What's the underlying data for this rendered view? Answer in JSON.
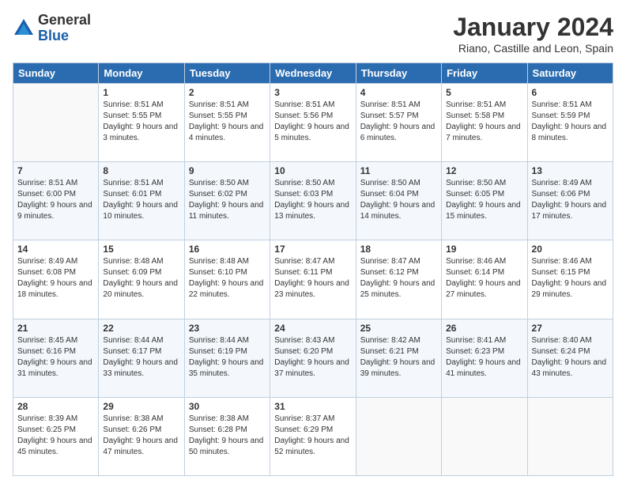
{
  "logo": {
    "general": "General",
    "blue": "Blue"
  },
  "header": {
    "title": "January 2024",
    "subtitle": "Riano, Castille and Leon, Spain"
  },
  "weekdays": [
    "Sunday",
    "Monday",
    "Tuesday",
    "Wednesday",
    "Thursday",
    "Friday",
    "Saturday"
  ],
  "weeks": [
    [
      {
        "day": "",
        "sunrise": "",
        "sunset": "",
        "daylight": ""
      },
      {
        "day": "1",
        "sunrise": "Sunrise: 8:51 AM",
        "sunset": "Sunset: 5:55 PM",
        "daylight": "Daylight: 9 hours and 3 minutes."
      },
      {
        "day": "2",
        "sunrise": "Sunrise: 8:51 AM",
        "sunset": "Sunset: 5:55 PM",
        "daylight": "Daylight: 9 hours and 4 minutes."
      },
      {
        "day": "3",
        "sunrise": "Sunrise: 8:51 AM",
        "sunset": "Sunset: 5:56 PM",
        "daylight": "Daylight: 9 hours and 5 minutes."
      },
      {
        "day": "4",
        "sunrise": "Sunrise: 8:51 AM",
        "sunset": "Sunset: 5:57 PM",
        "daylight": "Daylight: 9 hours and 6 minutes."
      },
      {
        "day": "5",
        "sunrise": "Sunrise: 8:51 AM",
        "sunset": "Sunset: 5:58 PM",
        "daylight": "Daylight: 9 hours and 7 minutes."
      },
      {
        "day": "6",
        "sunrise": "Sunrise: 8:51 AM",
        "sunset": "Sunset: 5:59 PM",
        "daylight": "Daylight: 9 hours and 8 minutes."
      }
    ],
    [
      {
        "day": "7",
        "sunrise": "Sunrise: 8:51 AM",
        "sunset": "Sunset: 6:00 PM",
        "daylight": "Daylight: 9 hours and 9 minutes."
      },
      {
        "day": "8",
        "sunrise": "Sunrise: 8:51 AM",
        "sunset": "Sunset: 6:01 PM",
        "daylight": "Daylight: 9 hours and 10 minutes."
      },
      {
        "day": "9",
        "sunrise": "Sunrise: 8:50 AM",
        "sunset": "Sunset: 6:02 PM",
        "daylight": "Daylight: 9 hours and 11 minutes."
      },
      {
        "day": "10",
        "sunrise": "Sunrise: 8:50 AM",
        "sunset": "Sunset: 6:03 PM",
        "daylight": "Daylight: 9 hours and 13 minutes."
      },
      {
        "day": "11",
        "sunrise": "Sunrise: 8:50 AM",
        "sunset": "Sunset: 6:04 PM",
        "daylight": "Daylight: 9 hours and 14 minutes."
      },
      {
        "day": "12",
        "sunrise": "Sunrise: 8:50 AM",
        "sunset": "Sunset: 6:05 PM",
        "daylight": "Daylight: 9 hours and 15 minutes."
      },
      {
        "day": "13",
        "sunrise": "Sunrise: 8:49 AM",
        "sunset": "Sunset: 6:06 PM",
        "daylight": "Daylight: 9 hours and 17 minutes."
      }
    ],
    [
      {
        "day": "14",
        "sunrise": "Sunrise: 8:49 AM",
        "sunset": "Sunset: 6:08 PM",
        "daylight": "Daylight: 9 hours and 18 minutes."
      },
      {
        "day": "15",
        "sunrise": "Sunrise: 8:48 AM",
        "sunset": "Sunset: 6:09 PM",
        "daylight": "Daylight: 9 hours and 20 minutes."
      },
      {
        "day": "16",
        "sunrise": "Sunrise: 8:48 AM",
        "sunset": "Sunset: 6:10 PM",
        "daylight": "Daylight: 9 hours and 22 minutes."
      },
      {
        "day": "17",
        "sunrise": "Sunrise: 8:47 AM",
        "sunset": "Sunset: 6:11 PM",
        "daylight": "Daylight: 9 hours and 23 minutes."
      },
      {
        "day": "18",
        "sunrise": "Sunrise: 8:47 AM",
        "sunset": "Sunset: 6:12 PM",
        "daylight": "Daylight: 9 hours and 25 minutes."
      },
      {
        "day": "19",
        "sunrise": "Sunrise: 8:46 AM",
        "sunset": "Sunset: 6:14 PM",
        "daylight": "Daylight: 9 hours and 27 minutes."
      },
      {
        "day": "20",
        "sunrise": "Sunrise: 8:46 AM",
        "sunset": "Sunset: 6:15 PM",
        "daylight": "Daylight: 9 hours and 29 minutes."
      }
    ],
    [
      {
        "day": "21",
        "sunrise": "Sunrise: 8:45 AM",
        "sunset": "Sunset: 6:16 PM",
        "daylight": "Daylight: 9 hours and 31 minutes."
      },
      {
        "day": "22",
        "sunrise": "Sunrise: 8:44 AM",
        "sunset": "Sunset: 6:17 PM",
        "daylight": "Daylight: 9 hours and 33 minutes."
      },
      {
        "day": "23",
        "sunrise": "Sunrise: 8:44 AM",
        "sunset": "Sunset: 6:19 PM",
        "daylight": "Daylight: 9 hours and 35 minutes."
      },
      {
        "day": "24",
        "sunrise": "Sunrise: 8:43 AM",
        "sunset": "Sunset: 6:20 PM",
        "daylight": "Daylight: 9 hours and 37 minutes."
      },
      {
        "day": "25",
        "sunrise": "Sunrise: 8:42 AM",
        "sunset": "Sunset: 6:21 PM",
        "daylight": "Daylight: 9 hours and 39 minutes."
      },
      {
        "day": "26",
        "sunrise": "Sunrise: 8:41 AM",
        "sunset": "Sunset: 6:23 PM",
        "daylight": "Daylight: 9 hours and 41 minutes."
      },
      {
        "day": "27",
        "sunrise": "Sunrise: 8:40 AM",
        "sunset": "Sunset: 6:24 PM",
        "daylight": "Daylight: 9 hours and 43 minutes."
      }
    ],
    [
      {
        "day": "28",
        "sunrise": "Sunrise: 8:39 AM",
        "sunset": "Sunset: 6:25 PM",
        "daylight": "Daylight: 9 hours and 45 minutes."
      },
      {
        "day": "29",
        "sunrise": "Sunrise: 8:38 AM",
        "sunset": "Sunset: 6:26 PM",
        "daylight": "Daylight: 9 hours and 47 minutes."
      },
      {
        "day": "30",
        "sunrise": "Sunrise: 8:38 AM",
        "sunset": "Sunset: 6:28 PM",
        "daylight": "Daylight: 9 hours and 50 minutes."
      },
      {
        "day": "31",
        "sunrise": "Sunrise: 8:37 AM",
        "sunset": "Sunset: 6:29 PM",
        "daylight": "Daylight: 9 hours and 52 minutes."
      },
      {
        "day": "",
        "sunrise": "",
        "sunset": "",
        "daylight": ""
      },
      {
        "day": "",
        "sunrise": "",
        "sunset": "",
        "daylight": ""
      },
      {
        "day": "",
        "sunrise": "",
        "sunset": "",
        "daylight": ""
      }
    ]
  ]
}
